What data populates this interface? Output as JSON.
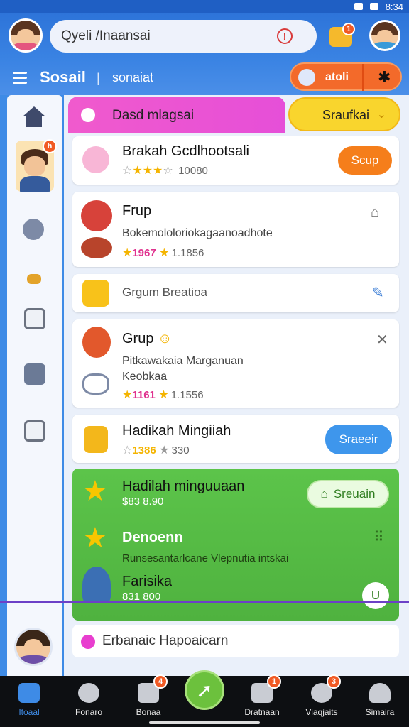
{
  "status_bar": {
    "time": "8:34"
  },
  "header": {
    "search_value": "Qyeli /Inaansai",
    "chat_badge": "1"
  },
  "nav": {
    "title": "Sosail",
    "separator": "|",
    "subtitle": "sonaiat",
    "pill_label": "atoli"
  },
  "tabs": {
    "pink_label": "Dasd mlagsai",
    "yellow_label": "Sraufkai"
  },
  "cards": [
    {
      "title": "Brakah Gcdlhootsali",
      "rating_text": "10080",
      "button": "Scup"
    },
    {
      "title": "Frup",
      "subtitle": "Bokemololoriokagaanoadhote",
      "price": "1967",
      "count": "1.1856"
    },
    {
      "title": "Grgum Breatioa"
    },
    {
      "title": "Grup",
      "subtitle_line1": "Pitkawakaia Marganuan",
      "subtitle_line2": "Keobkaa",
      "price": "1161",
      "count": "1.1556"
    },
    {
      "title": "Hadikah Mingiiah",
      "price": "1386",
      "count": "330",
      "button": "Sraeeir"
    }
  ],
  "green_section": {
    "item1_title": "Hadilah minguuaan",
    "item1_price": "$83 8.90",
    "item1_button": "Sreuain",
    "item2_title": "Denoenn",
    "item2_sub": "Runsesantarlcane Vlepnutia intskai",
    "item3_title": "Farisika",
    "item3_price": "831 800",
    "item3_badge": "U"
  },
  "notification": {
    "text": "Erbanaic Hapoaicarn"
  },
  "bottom_nav": [
    {
      "label": "Itoaal"
    },
    {
      "label": "Fonaro"
    },
    {
      "label": "Bonaa",
      "badge": "4"
    },
    {
      "label": "Dratnaan",
      "badge": "1"
    },
    {
      "label": "Viaqjaits",
      "badge": "3"
    },
    {
      "label": "Simaira"
    }
  ],
  "colors": {
    "primary_blue": "#3e8be6",
    "accent_orange": "#f36a2a",
    "accent_pink": "#f05acd",
    "accent_yellow": "#f9d52d",
    "accent_green": "#5cc44a"
  }
}
